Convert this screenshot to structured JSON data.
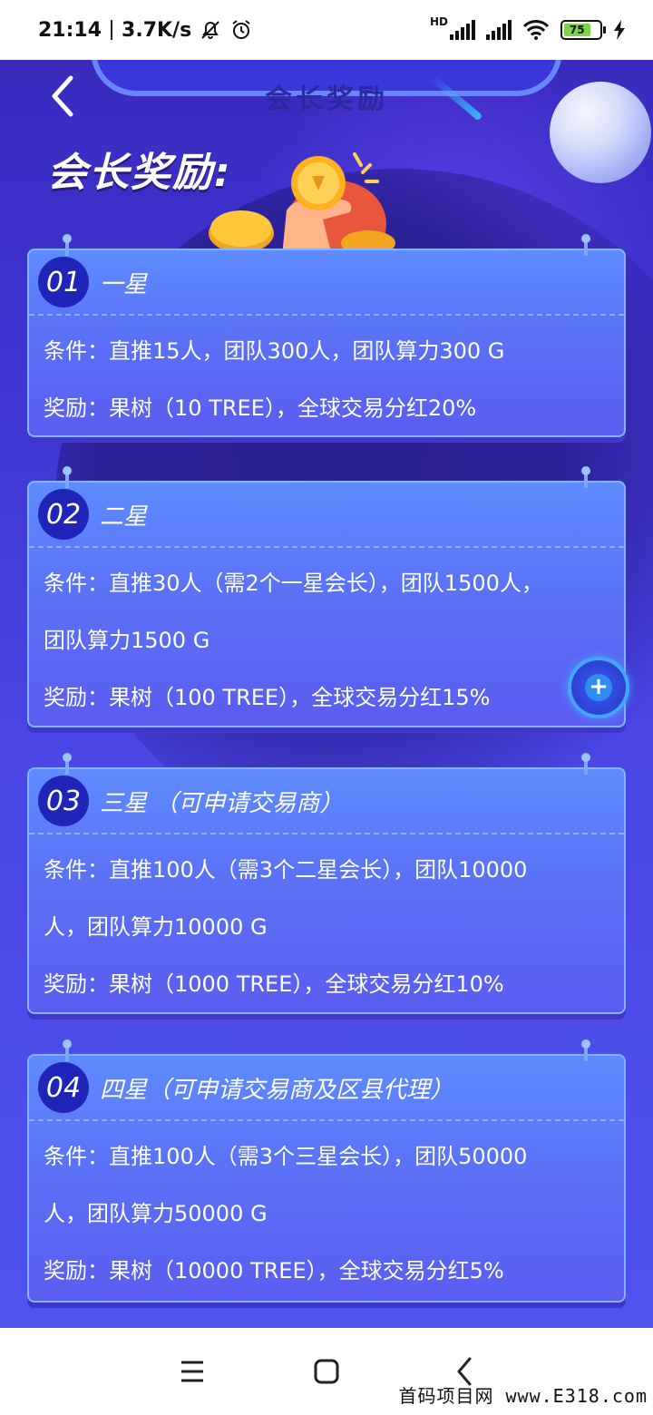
{
  "status_bar": {
    "time": "21:14",
    "speed": "3.7K/s",
    "network_label": "HD",
    "battery": "75"
  },
  "header": {
    "nav_title": "会长奖励",
    "hero_title": "会长奖励:"
  },
  "cards": [
    {
      "number": "01",
      "title": "一星",
      "lines": [
        "条件：直推15人，团队300人，团队算力300 G",
        "奖励：果树（10 TREE），全球交易分红20%"
      ]
    },
    {
      "number": "02",
      "title": "二星",
      "lines": [
        "条件：直推30人（需2个一星会长），团队1500人，",
        "团队算力1500  G",
        "奖励：果树（100 TREE），全球交易分红15%"
      ]
    },
    {
      "number": "03",
      "title": "三星 （可申请交易商）",
      "lines": [
        "条件：直推100人（需3个二星会长），团队10000",
        "人，团队算力10000  G",
        "奖励：果树（1000 TREE），全球交易分红10%"
      ]
    },
    {
      "number": "04",
      "title": "四星（可申请交易商及区县代理）",
      "lines": [
        "条件：直推100人（需3个三星会长），团队50000",
        "人，团队算力50000  G",
        "奖励：果树（10000 TREE），全球交易分红5%"
      ]
    }
  ],
  "fab": {
    "icon": "plus-icon"
  },
  "watermark": "首码项目网 www.E318.com",
  "colors": {
    "background": "#4a3fe0",
    "card": "#5a72f6",
    "badge": "#1e25b8"
  }
}
